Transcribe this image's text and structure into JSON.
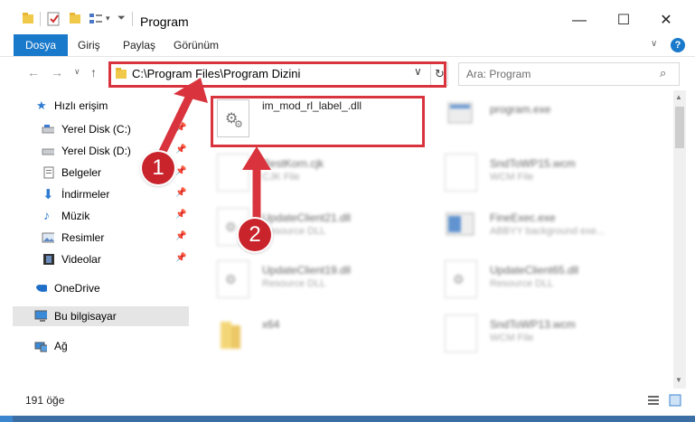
{
  "window": {
    "title": "Program",
    "minimize": "—",
    "maximize": "☐",
    "close": "✕"
  },
  "ribbon": {
    "tabs": [
      "Dosya",
      "Giriş",
      "Paylaş",
      "Görünüm"
    ],
    "help": "?"
  },
  "address": {
    "path": "C:\\Program Files\\Program Dizini",
    "search_placeholder": "Ara: Program"
  },
  "sidebar": {
    "items": [
      {
        "label": "Hızlı erişim"
      },
      {
        "label": "Yerel Disk (C:)"
      },
      {
        "label": "Yerel Disk (D:)"
      },
      {
        "label": "Belgeler"
      },
      {
        "label": "İndirmeler"
      },
      {
        "label": "Müzik"
      },
      {
        "label": "Resimler"
      },
      {
        "label": "Videolar"
      },
      {
        "label": "OneDrive"
      },
      {
        "label": "Bu bilgisayar"
      },
      {
        "label": "Ağ"
      }
    ]
  },
  "files": [
    {
      "name": "im_mod_rl_label_.dll",
      "type": ""
    },
    {
      "name": "program.exe",
      "type": ""
    },
    {
      "name": "RestKorn.cjk",
      "type": "CJK File"
    },
    {
      "name": "SndToWP15.wcm",
      "type": "WCM File"
    },
    {
      "name": "UpdateClient21.dll",
      "type": "Resource DLL"
    },
    {
      "name": "FineExec.exe",
      "type": "ABBYY background exe..."
    },
    {
      "name": "UpdateClient19.dll",
      "type": "Resource DLL"
    },
    {
      "name": "UpdateClient65.dll",
      "type": "Resource DLL"
    },
    {
      "name": "x64",
      "type": ""
    },
    {
      "name": "SndToWP13.wcm",
      "type": "WCM File"
    }
  ],
  "annotations": {
    "step1": "1",
    "step2": "2"
  },
  "status": {
    "count": "191 öğe"
  },
  "colors": {
    "accent": "#1979ca",
    "annotation": "#d9343d"
  }
}
